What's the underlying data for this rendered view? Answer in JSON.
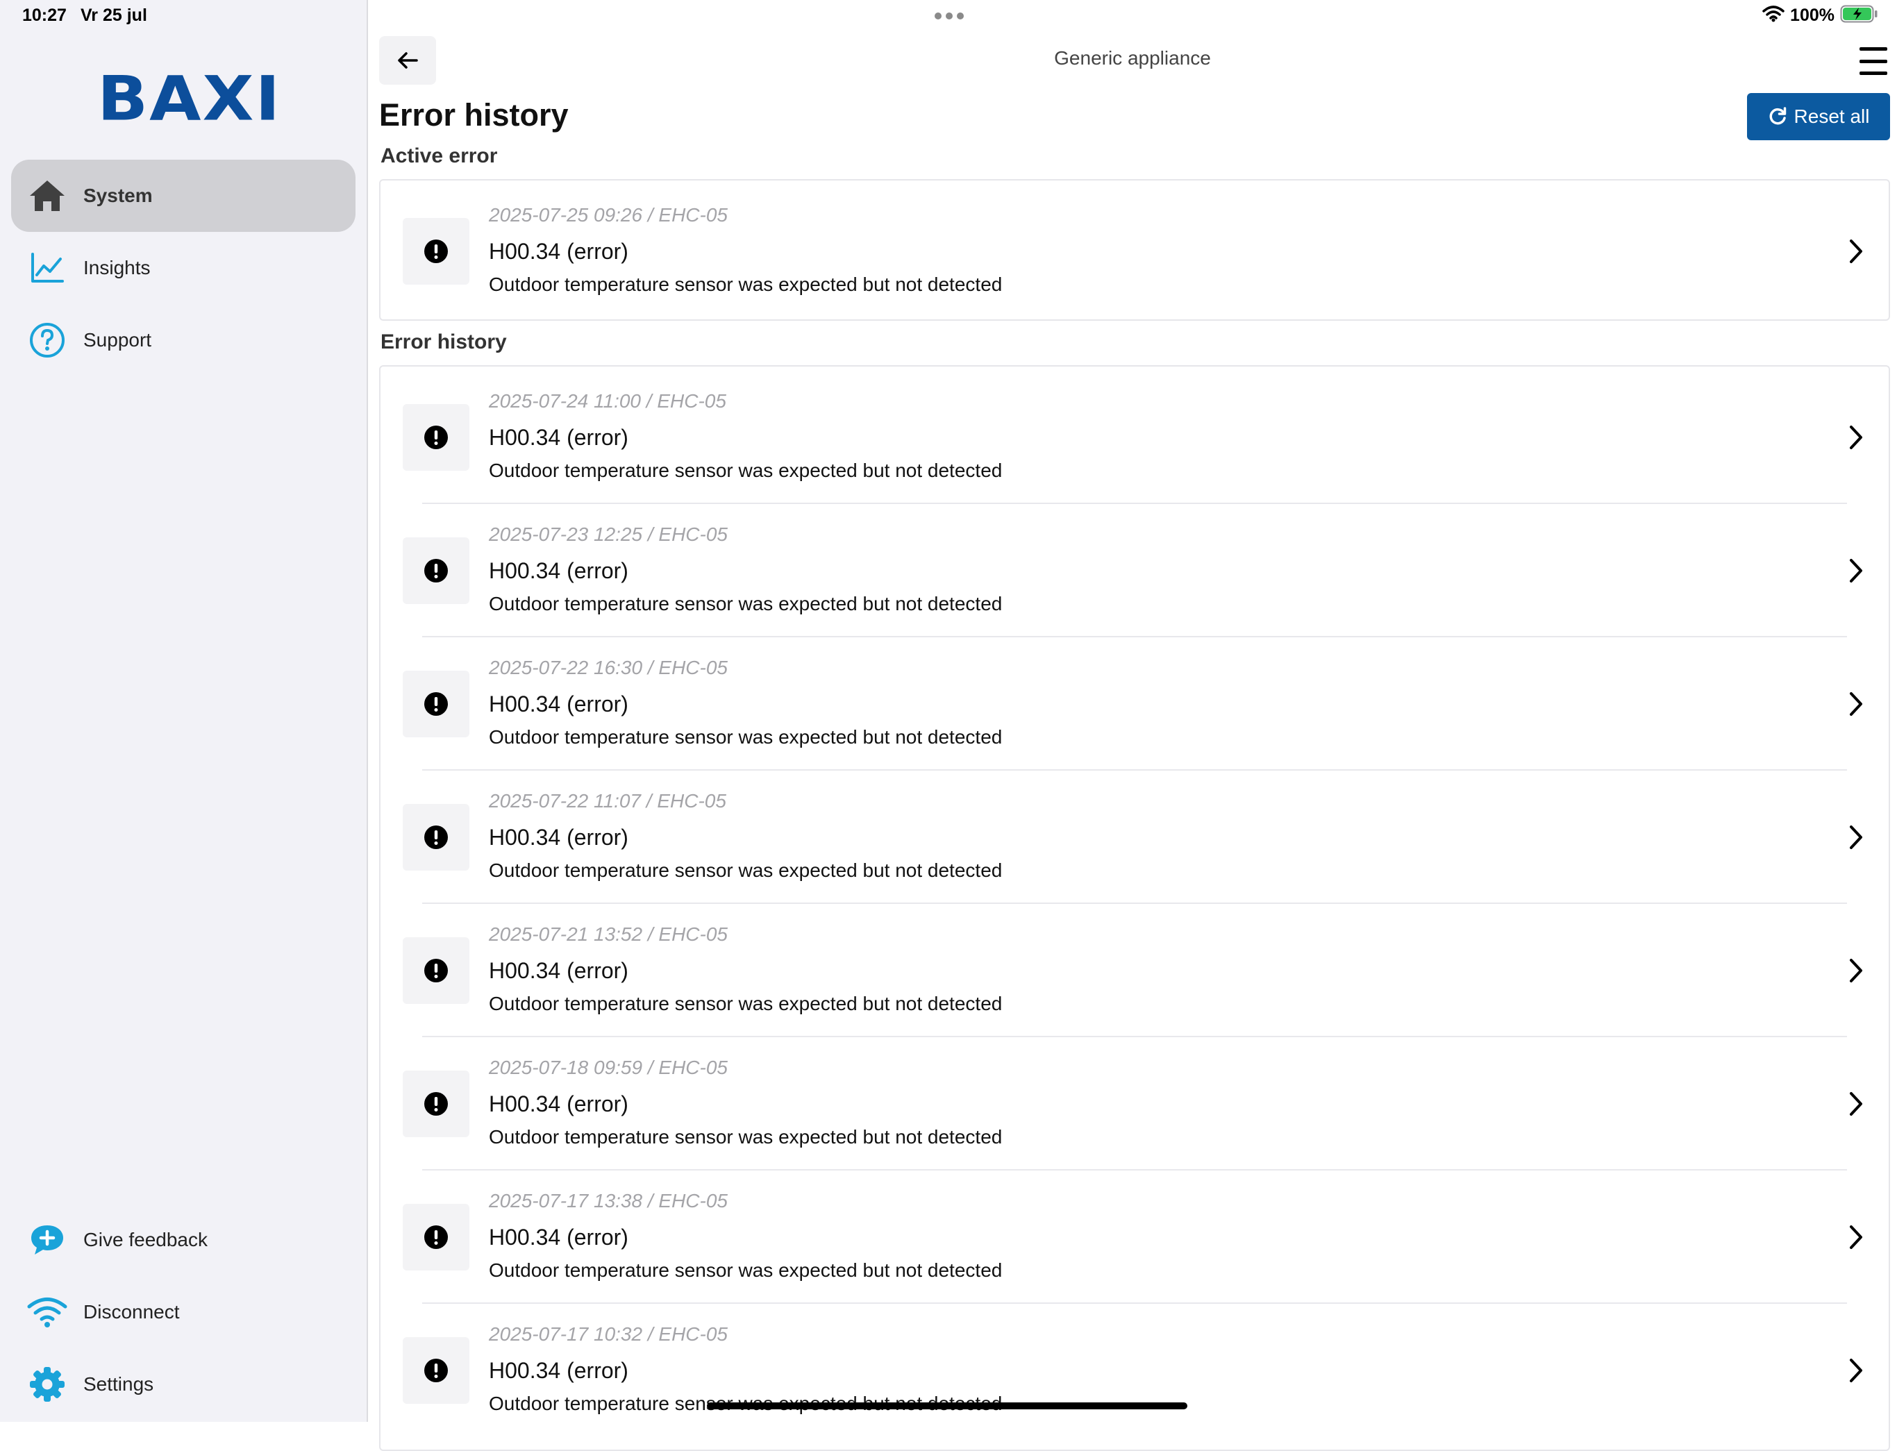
{
  "status_bar": {
    "time": "10:27",
    "date": "Vr 25 jul",
    "battery": "100%"
  },
  "sidebar": {
    "logo": "BAXI",
    "items": [
      {
        "label": "System",
        "icon": "home-icon",
        "active": true
      },
      {
        "label": "Insights",
        "icon": "chart-line-icon",
        "active": false
      },
      {
        "label": "Support",
        "icon": "question-circle-icon",
        "active": false
      }
    ],
    "bottom_items": [
      {
        "label": "Give feedback",
        "icon": "feedback-bubble-icon"
      },
      {
        "label": "Disconnect",
        "icon": "wifi-icon"
      },
      {
        "label": "Settings",
        "icon": "gear-icon"
      }
    ]
  },
  "header": {
    "title": "Generic appliance"
  },
  "page": {
    "title": "Error history",
    "reset_label": "Reset all",
    "active_section": "Active error",
    "history_section": "Error history"
  },
  "active_errors": [
    {
      "meta": "2025-07-25 09:26 / EHC-05",
      "code": "H00.34 (error)",
      "description": "Outdoor temperature sensor was expected but not detected"
    }
  ],
  "history_errors": [
    {
      "meta": "2025-07-24 11:00 / EHC-05",
      "code": "H00.34 (error)",
      "description": "Outdoor temperature sensor was expected but not detected"
    },
    {
      "meta": "2025-07-23 12:25 / EHC-05",
      "code": "H00.34 (error)",
      "description": "Outdoor temperature sensor was expected but not detected"
    },
    {
      "meta": "2025-07-22 16:30 / EHC-05",
      "code": "H00.34 (error)",
      "description": "Outdoor temperature sensor was expected but not detected"
    },
    {
      "meta": "2025-07-22 11:07 / EHC-05",
      "code": "H00.34 (error)",
      "description": "Outdoor temperature sensor was expected but not detected"
    },
    {
      "meta": "2025-07-21 13:52 / EHC-05",
      "code": "H00.34 (error)",
      "description": "Outdoor temperature sensor was expected but not detected"
    },
    {
      "meta": "2025-07-18 09:59 / EHC-05",
      "code": "H00.34 (error)",
      "description": "Outdoor temperature sensor was expected but not detected"
    },
    {
      "meta": "2025-07-17 13:38 / EHC-05",
      "code": "H00.34 (error)",
      "description": "Outdoor temperature sensor was expected but not detected"
    },
    {
      "meta": "2025-07-17 10:32 / EHC-05",
      "code": "H00.34 (error)",
      "description": "Outdoor temperature sensor was expected but not detected"
    }
  ],
  "colors": {
    "brand": "#0c4e9b",
    "accent": "#1aa3d9",
    "button": "#0c5aa0",
    "sidebar_bg": "#f2f2f7"
  }
}
